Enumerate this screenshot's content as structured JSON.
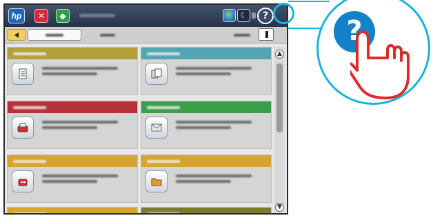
{
  "topbar": {
    "logo_text": "hp",
    "stop_symbol": "✕",
    "start_symbol": "◆",
    "moon_symbol": "☾",
    "help_symbol": "?"
  },
  "callout": {
    "help_symbol": "?"
  },
  "scroll": {
    "up_symbol": "▲",
    "down_symbol": "▼"
  },
  "tiles": [
    {
      "color": "#b3a03a",
      "icon": "document-icon"
    },
    {
      "color": "#53a5b3",
      "icon": "copy-icon"
    },
    {
      "color": "#b5323b",
      "icon": "fax-icon"
    },
    {
      "color": "#3d9e4a",
      "icon": "email-icon"
    },
    {
      "color": "#d6a52c",
      "icon": "usb-icon"
    },
    {
      "color": "#d6a52c",
      "icon": "folder-icon"
    },
    {
      "color": "#d6a52c",
      "icon": "device-memory-icon"
    },
    {
      "color": "#7d7a2f",
      "icon": "retrieve-icon"
    }
  ],
  "colors": {
    "accent": "#18b2e0",
    "help_blue": "#1581c9",
    "topbar": "#2f3f57"
  }
}
